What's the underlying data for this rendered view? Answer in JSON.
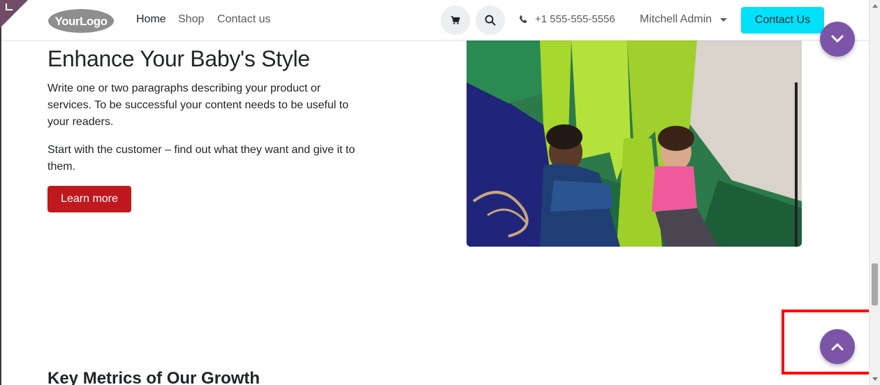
{
  "header": {
    "logo_text": "YourLogo",
    "nav": [
      {
        "label": "Home",
        "active": true
      },
      {
        "label": "Shop",
        "active": false
      },
      {
        "label": "Contact us",
        "active": false
      }
    ],
    "phone": "+1 555-555-5556",
    "user_name": "Mitchell Admin",
    "cta_label": "Contact Us"
  },
  "hero": {
    "title": "Enhance Your Baby's Style",
    "paragraph_1": "Write one or two paragraphs describing your product or services. To be successful your content needs to be useful to your readers.",
    "paragraph_2": "Start with the customer – find out what they want and give it to them.",
    "button_label": "Learn more"
  },
  "metrics": {
    "title": "Key Metrics of Our Growth"
  },
  "colors": {
    "accent_purple": "#7c55a8",
    "cta_cyan": "#00e1f9",
    "button_red": "#c0181f",
    "highlight_red": "#ff0000"
  },
  "icons": [
    "cart-icon",
    "search-icon",
    "phone-icon",
    "chevron-down-icon",
    "chevron-up-icon"
  ]
}
